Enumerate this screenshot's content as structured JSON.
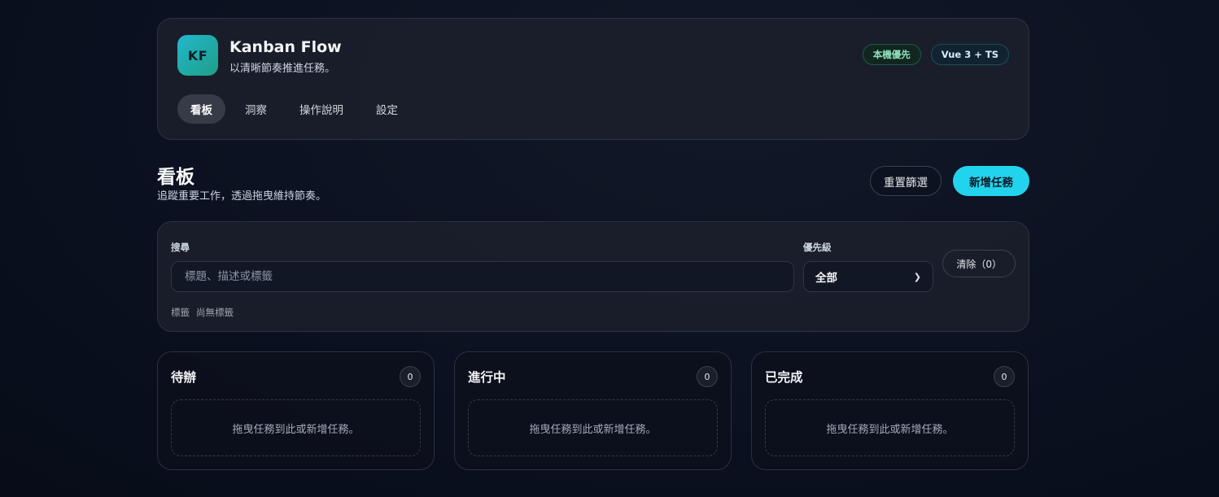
{
  "app": {
    "logo_text": "KF",
    "title": "Kanban Flow",
    "subtitle": "以清晰節奏推進任務。",
    "badges": [
      "本機優先",
      "Vue 3 + TS"
    ]
  },
  "nav": {
    "tabs": [
      {
        "label": "看板",
        "active": true
      },
      {
        "label": "洞察",
        "active": false
      },
      {
        "label": "操作說明",
        "active": false
      },
      {
        "label": "設定",
        "active": false
      }
    ]
  },
  "page": {
    "title": "看板",
    "description": "追蹤重要工作，透過拖曳維持節奏。",
    "reset_button": "重置篩選",
    "new_button": "新增任務"
  },
  "filters": {
    "search_label": "搜尋",
    "search_placeholder": "標題、描述或標籤",
    "search_value": "",
    "priority_label": "優先級",
    "priority_value": "全部",
    "clear_button": "清除（0）",
    "tags_label": "標籤",
    "tags_empty": "尚無標籤"
  },
  "columns": [
    {
      "title": "待辦",
      "count": "0",
      "empty_text": "拖曳任務到此或新增任務。"
    },
    {
      "title": "進行中",
      "count": "0",
      "empty_text": "拖曳任務到此或新增任務。"
    },
    {
      "title": "已完成",
      "count": "0",
      "empty_text": "拖曳任務到此或新增任務。"
    }
  ],
  "icons": {
    "select_chevron": "chevron-down-icon"
  },
  "colors": {
    "accent": "#22d3ee",
    "logo_gradient_start": "#22b8cf",
    "logo_gradient_end": "#1f9e84",
    "badge_local_text": "#8fe0bd"
  }
}
